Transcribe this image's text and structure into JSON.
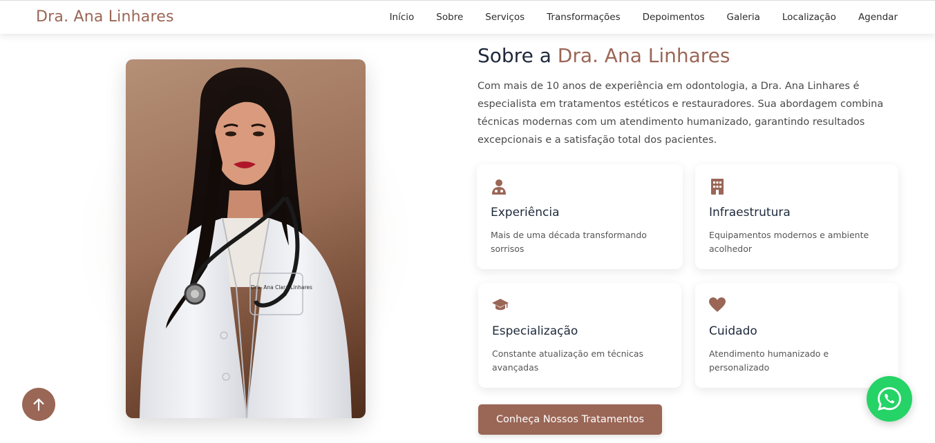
{
  "brand": "Dra. Ana Linhares",
  "nav": [
    {
      "label": "Início"
    },
    {
      "label": "Sobre"
    },
    {
      "label": "Serviços"
    },
    {
      "label": "Transformações"
    },
    {
      "label": "Depoimentos"
    },
    {
      "label": "Galeria"
    },
    {
      "label": "Localização"
    },
    {
      "label": "Agendar"
    }
  ],
  "about": {
    "title_prefix": "Sobre a",
    "title_name": "Dra. Ana Linhares",
    "text": "Com mais de 10 anos de experiência em odontologia, a Dra. Ana Linhares é especialista em tratamentos estéticos e restauradores. Sua abordagem combina técnicas modernas com um atendimento humanizado, garantindo resultados excepcionais e a satisfação total dos pacientes."
  },
  "photo": {
    "coat_name": "Dra. Ana Clara Linhares"
  },
  "cards": [
    {
      "icon": "doctor-icon",
      "title": "Experiência",
      "desc": "Mais de uma década transformando sorrisos"
    },
    {
      "icon": "hospital-icon",
      "title": "Infraestrutura",
      "desc": "Equipamentos modernos e ambiente acolhedor"
    },
    {
      "icon": "graduation-cap-icon",
      "title": "Especialização",
      "desc": "Constante atualização em técnicas avançadas"
    },
    {
      "icon": "heart-icon",
      "title": "Cuidado",
      "desc": "Atendimento humanizado e personalizado"
    }
  ],
  "cta": {
    "label": "Conheça Nossos Tratamentos"
  },
  "floating": {
    "back_to_top_icon": "arrow-up-icon",
    "whatsapp_icon": "whatsapp-icon"
  },
  "colors": {
    "accent": "#9a6656",
    "whatsapp": "#25d366",
    "heading": "#1e293b"
  }
}
